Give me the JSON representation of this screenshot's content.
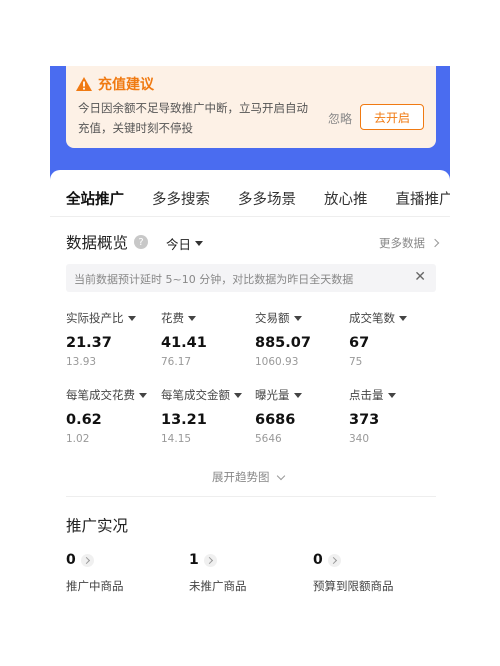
{
  "alert": {
    "title": "充值建议",
    "message": "今日因余额不足导致推广中断，立马开启自动充值，关键时刻不停投",
    "ignore_label": "忽略",
    "action_label": "去开启"
  },
  "tabs": [
    {
      "label": "全站推广",
      "active": true
    },
    {
      "label": "多多搜索",
      "active": false
    },
    {
      "label": "多多场景",
      "active": false
    },
    {
      "label": "放心推",
      "active": false
    },
    {
      "label": "直播推广",
      "active": false
    }
  ],
  "overview": {
    "title": "数据概览",
    "help_icon": "?",
    "date_range": "今日",
    "more_label": "更多数据",
    "notice": "当前数据预计延时 5~10 分钟，对比数据为昨日全天数据",
    "notice_close": "✕",
    "metrics": [
      {
        "label": "实际投产比",
        "value": "21.37",
        "compare": "13.93"
      },
      {
        "label": "花费",
        "value": "41.41",
        "compare": "76.17"
      },
      {
        "label": "交易额",
        "value": "885.07",
        "compare": "1060.93"
      },
      {
        "label": "成交笔数",
        "value": "67",
        "compare": "75"
      },
      {
        "label": "每笔成交花费",
        "value": "0.62",
        "compare": "1.02"
      },
      {
        "label": "每笔成交金额",
        "value": "13.21",
        "compare": "14.15"
      },
      {
        "label": "曝光量",
        "value": "6686",
        "compare": "5646"
      },
      {
        "label": "点击量",
        "value": "373",
        "compare": "340"
      }
    ],
    "expand_label": "展开趋势图"
  },
  "promo_status": {
    "title": "推广实况",
    "items": [
      {
        "count": "0",
        "label": "推广中商品"
      },
      {
        "count": "1",
        "label": "未推广商品"
      },
      {
        "count": "0",
        "label": "预算到限额商品"
      }
    ]
  },
  "colors": {
    "accent_orange": "#f07a12",
    "header_blue": "#4a6cf0",
    "alert_bg": "#fdf1e6"
  }
}
